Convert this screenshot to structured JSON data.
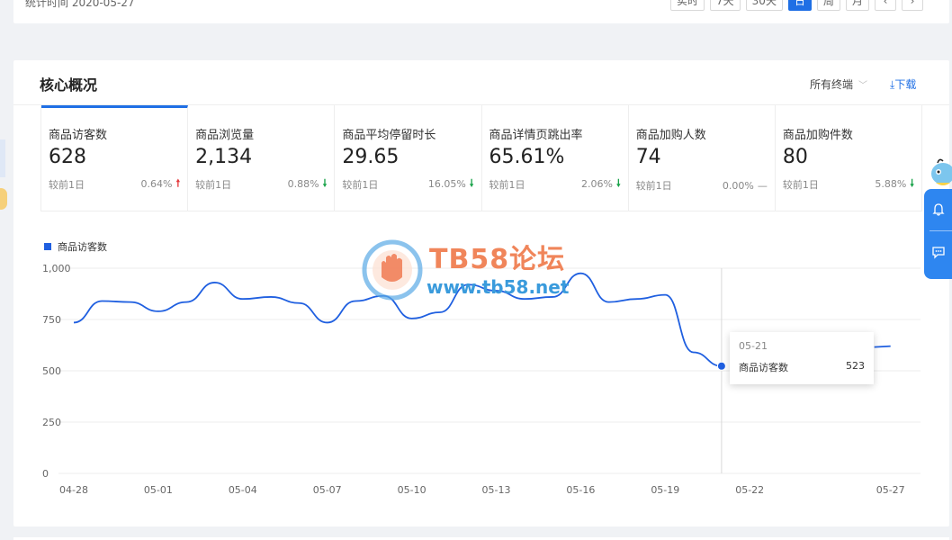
{
  "header": {
    "stat_time": "统计时间 2020-05-27",
    "ranges": [
      "实时",
      "7天",
      "30天",
      "日",
      "周",
      "月",
      "‹",
      "›"
    ],
    "active_range": "日"
  },
  "overview": {
    "title": "核心概况",
    "terminal_select": "所有终端",
    "download_label": "下载"
  },
  "kpis": [
    {
      "label": "商品访客数",
      "value": "628",
      "compare_label": "较前1日",
      "pct": "0.64%",
      "trend": "up"
    },
    {
      "label": "商品浏览量",
      "value": "2,134",
      "compare_label": "较前1日",
      "pct": "0.88%",
      "trend": "down"
    },
    {
      "label": "商品平均停留时长",
      "value": "29.65",
      "compare_label": "较前1日",
      "pct": "16.05%",
      "trend": "down"
    },
    {
      "label": "商品详情页跳出率",
      "value": "65.61%",
      "compare_label": "较前1日",
      "pct": "2.06%",
      "trend": "down"
    },
    {
      "label": "商品加购人数",
      "value": "74",
      "compare_label": "较前1日",
      "pct": "0.00%",
      "trend": "flat"
    },
    {
      "label": "商品加购件数",
      "value": "80",
      "compare_label": "较前1日",
      "pct": "5.88%",
      "trend": "down"
    }
  ],
  "legend": {
    "label": "商品访客数",
    "color": "#1f5fe0"
  },
  "tooltip": {
    "date": "05-21",
    "series": "商品访客数",
    "value": "523"
  },
  "watermark": {
    "title": "TB58论坛",
    "url": "www.tb58.net"
  },
  "chart_data": {
    "type": "line",
    "series": [
      {
        "name": "商品访客数",
        "x": [
          "04-28",
          "04-29",
          "04-30",
          "05-01",
          "05-02",
          "05-03",
          "05-04",
          "05-05",
          "05-06",
          "05-07",
          "05-08",
          "05-09",
          "05-10",
          "05-11",
          "05-12",
          "05-13",
          "05-14",
          "05-15",
          "05-16",
          "05-17",
          "05-18",
          "05-19",
          "05-20",
          "05-21",
          "05-27"
        ],
        "values": [
          735,
          840,
          835,
          790,
          835,
          930,
          850,
          860,
          830,
          735,
          840,
          865,
          755,
          785,
          920,
          890,
          850,
          860,
          975,
          835,
          850,
          870,
          590,
          523,
          620
        ]
      }
    ],
    "ylim": [
      0,
      1000
    ],
    "y_ticks": [
      "1,000",
      "750",
      "500",
      "250",
      "0"
    ],
    "x_ticks": [
      "04-28",
      "05-01",
      "05-04",
      "05-07",
      "05-10",
      "05-13",
      "05-16",
      "05-19",
      "05-22",
      "05-27"
    ],
    "highlight": "05-21",
    "grid": true
  },
  "colors": {
    "accent": "#1f6fe5",
    "up": "#e4393c",
    "down": "#1aa34a"
  }
}
